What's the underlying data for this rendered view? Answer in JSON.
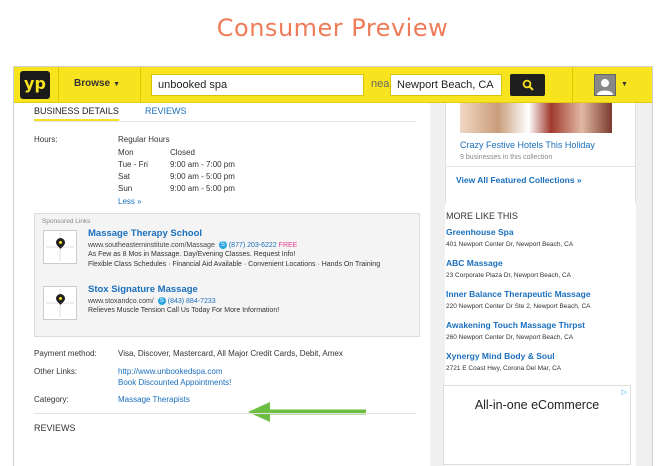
{
  "heading": "Consumer Preview",
  "colors": {
    "brand_yellow": "#f8e31f",
    "link_blue": "#1a6fbd",
    "arrow_green": "#6fbe44",
    "heading_orange": "#ee7c58"
  },
  "header": {
    "logo": "yp",
    "browse_label": "Browse",
    "search_value": "unbooked spa",
    "near_label": "near",
    "location_value": "Newport Beach, CA",
    "search_icon": "search-icon",
    "user_icon": "user-icon"
  },
  "tabs": {
    "active": "BUSINESS DETAILS",
    "reviews": "REVIEWS"
  },
  "hours": {
    "label": "Hours:",
    "title": "Regular Hours",
    "rows": [
      {
        "day": "Mon",
        "time": "Closed"
      },
      {
        "day": "Tue - Fri",
        "time": "9:00 am - 7:00 pm"
      },
      {
        "day": "Sat",
        "time": "9:00 am - 5:00 pm"
      },
      {
        "day": "Sun",
        "time": "9:00 am - 5:00 pm"
      }
    ],
    "less": "Less »"
  },
  "sponsored": {
    "label": "Sponsored Links",
    "ads": [
      {
        "title": "Massage Therapy School",
        "url": "www.southeasterninstitute.com/Massage",
        "phone": "(877) 203-6222",
        "free": "FREE",
        "line2": "As Few as 8 Mos in Massage. Day/Evening Classes. Request Info!",
        "line3": "Flexible Class Schedules · Financial Aid Available · Convenient Locations · Hands On Training"
      },
      {
        "title": "Stox Signature Massage",
        "url": "www.stoxandco.com/",
        "phone": "(843) 884-7233",
        "line2": "Relieves Muscle Tension Call Us Today For More Information!"
      }
    ]
  },
  "details": {
    "payment_label": "Payment method:",
    "payment_value": "Visa, Discover, Mastercard, All Major Credit Cards, Debit, Amex",
    "links_label": "Other Links:",
    "link1": "http://www.unbookedspa.com",
    "link2": "Book Discounted Appointments!",
    "category_label": "Category:",
    "category_value": "Massage Therapists",
    "reviews_heading": "REVIEWS"
  },
  "sidebar": {
    "featured_title": "Crazy Festive Hotels This Holiday",
    "featured_sub": "9 businesses in this collection",
    "view_all": "View All Featured Collections »",
    "more_title": "MORE LIKE THIS",
    "businesses": [
      {
        "name": "Greenhouse Spa",
        "address": "401 Newport Center Dr, Newport Beach, CA"
      },
      {
        "name": "ABC Massage",
        "address": "23 Corporate Plaza Dr, Newport Beach, CA"
      },
      {
        "name": "Inner Balance Therapeutic Massage",
        "address": "220 Newport Center Dr Ste 2, Newport Beach, CA"
      },
      {
        "name": "Awakening Touch Massage Thrpst",
        "address": "260 Newport Center Dr, Newport Beach, CA"
      },
      {
        "name": "Xynergy Mind Body & Soul",
        "address": "2721 E Coast Hwy, Corona Del Mar, CA"
      }
    ],
    "ad_headline": "All-in-one eCommerce"
  }
}
